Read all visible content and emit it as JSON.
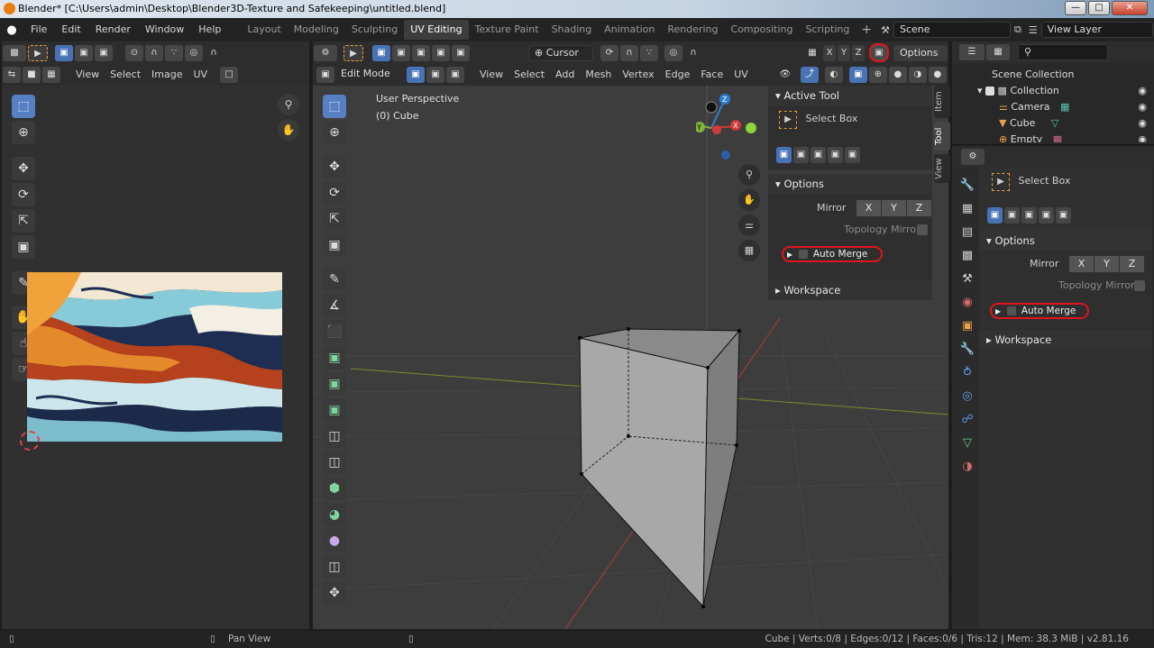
{
  "window": {
    "title": "Blender* [C:\\Users\\admin\\Desktop\\Blender3D-Texture and Safekeeping\\untitled.blend]"
  },
  "menu": {
    "items": [
      "File",
      "Edit",
      "Render",
      "Window",
      "Help"
    ]
  },
  "workspaces": [
    "Layout",
    "Modeling",
    "Sculpting",
    "UV Editing",
    "Texture Paint",
    "Shading",
    "Animation",
    "Rendering",
    "Compositing",
    "Scripting"
  ],
  "workspace_active": "UV Editing",
  "scene": {
    "name": "Scene",
    "view_layer": "View Layer"
  },
  "uv_editor": {
    "menus": [
      "View",
      "Select",
      "Image",
      "UV"
    ]
  },
  "viewport": {
    "mode": "Edit Mode",
    "menus": [
      "View",
      "Select",
      "Add",
      "Mesh",
      "Vertex",
      "Edge",
      "Face",
      "UV"
    ],
    "pivot": "Cursor",
    "options": "Options",
    "info_line1": "User Perspective",
    "info_line2": "(0) Cube",
    "axes": {
      "x": "X",
      "y": "Y",
      "z": "Z"
    }
  },
  "sidebar": {
    "tabs": [
      "Item",
      "Tool",
      "View"
    ],
    "active_tool_header": "Active Tool",
    "tool_name": "Select Box",
    "options_header": "Options",
    "mirror_label": "Mirror",
    "axes": [
      "X",
      "Y",
      "Z"
    ],
    "topology_mirror": "Topology Mirror",
    "auto_merge": "Auto Merge",
    "workspace_header": "Workspace"
  },
  "outliner": {
    "root": "Scene Collection",
    "collection": "Collection",
    "items": [
      "Camera",
      "Cube",
      "Empty"
    ]
  },
  "properties": {
    "tool_name": "Select Box",
    "options_header": "Options",
    "mirror_label": "Mirror",
    "axes": [
      "X",
      "Y",
      "Z"
    ],
    "topology_mirror": "Topology Mirror",
    "auto_merge": "Auto Merge",
    "workspace_header": "Workspace"
  },
  "status": {
    "pan_view": "Pan View",
    "stats": "Cube | Verts:0/8 | Edges:0/12 | Faces:0/6 | Tris:12 | Mem: 38.3 MiB | v2.81.16"
  },
  "colors": {
    "accent": "#4772b3",
    "highlight": "#e0141e",
    "background": "#303030"
  }
}
